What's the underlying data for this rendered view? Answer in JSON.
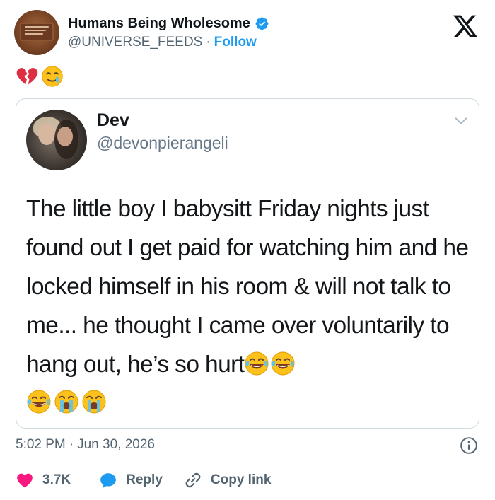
{
  "header": {
    "display_name": "Humans Being Wholesome",
    "handle": "@UNIVERSE_FEEDS",
    "separator": "·",
    "follow_label": "Follow",
    "verified": true,
    "logo_icon": "x-logo-icon"
  },
  "post": {
    "emojis": [
      "broken-heart-icon",
      "crying-smiling-face-icon"
    ]
  },
  "quoted_tweet": {
    "name": "Dev",
    "handle": "@devonpierangeli",
    "text": "The little boy I babysitt Friday nights just found out I get paid for watching him and he locked himself in his room & will not talk to me... he thought I came over voluntarily to hang out, he’s so hurt",
    "trailing_emojis": [
      "face-with-tears-of-joy-icon",
      "face-with-tears-of-joy-icon"
    ],
    "next_line_emojis": [
      "face-with-tears-of-joy-icon",
      "loudly-crying-face-icon",
      "loudly-crying-face-icon"
    ]
  },
  "meta": {
    "time": "5:02 PM",
    "separator": "·",
    "date": "Jun 30, 2026"
  },
  "actions": {
    "like_count": "3.7K",
    "reply_label": "Reply",
    "copy_link_label": "Copy link"
  },
  "colors": {
    "accent": "#1d9bf0",
    "like": "#f91880",
    "secondary_text": "#536471",
    "border": "#cfd9de"
  }
}
